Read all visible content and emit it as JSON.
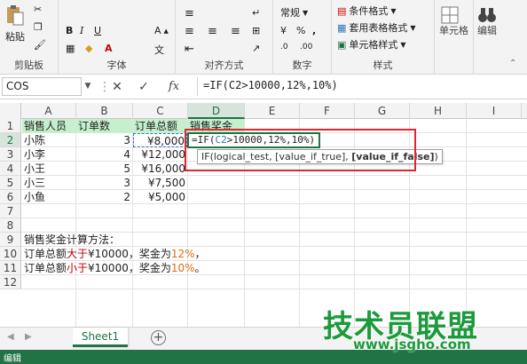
{
  "ribbon": {
    "clipboard": {
      "paste": "粘贴",
      "label": "剪贴板"
    },
    "font": {
      "label": "字体"
    },
    "alignment": {
      "label": "对齐方式"
    },
    "number": {
      "format": "常规",
      "label": "数字"
    },
    "styles": {
      "conditional": "条件格式",
      "table_format": "套用表格格式",
      "cell_styles": "单元格样式",
      "label": "样式"
    },
    "cells": {
      "label": "单元格"
    },
    "editing": {
      "label": "编辑"
    }
  },
  "formula_bar": {
    "name_box": "COS",
    "formula": "=IF(C2>10000,12%,10%)"
  },
  "columns": [
    "A",
    "B",
    "C",
    "D",
    "E",
    "F",
    "G",
    "H",
    "I"
  ],
  "rows": [
    "1",
    "2",
    "3",
    "4",
    "5",
    "6",
    "7",
    "8",
    "9",
    "10",
    "11",
    "12"
  ],
  "table": {
    "headers": [
      "销售人员",
      "订单数",
      "订单总额",
      "销售奖金"
    ],
    "rows": [
      [
        "小陈",
        "3",
        "¥8,000"
      ],
      [
        "小李",
        "4",
        "¥12,000"
      ],
      [
        "小王",
        "5",
        "¥16,000"
      ],
      [
        "小三",
        "3",
        "¥7,500"
      ],
      [
        "小鱼",
        "2",
        "¥5,000"
      ]
    ]
  },
  "active_cell": {
    "prefix": "=IF(",
    "ref": "C2",
    "rest": ">10000,12%,10%)"
  },
  "tooltip": {
    "fn": "IF(logical_test, [value_if_true], ",
    "bold": "[value_if_false]",
    "end": ")"
  },
  "notes": {
    "title": "销售奖金计算方法：",
    "line1": {
      "a": "订单总额",
      "b": "大于",
      "c": "¥10000，奖金为",
      "d": "12%",
      "e": "，"
    },
    "line2": {
      "a": "订单总额",
      "b": "小于",
      "c": "¥10000，奖金为",
      "d": "10%",
      "e": "。"
    }
  },
  "sheet_tab": "Sheet1",
  "status": "编辑",
  "watermark": {
    "title": "技术员联盟",
    "url": "www.jsgho.com"
  },
  "colors": {
    "accent": "#217346",
    "header_fill": "#c6efce",
    "highlight_red": "#e0262b"
  }
}
